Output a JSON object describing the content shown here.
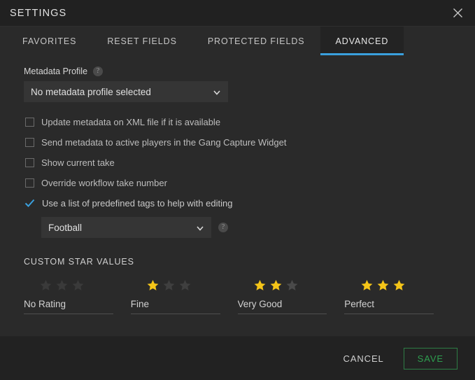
{
  "window": {
    "title": "SETTINGS",
    "close_icon": "close-icon"
  },
  "tabs": [
    {
      "label": "FAVORITES",
      "active": false
    },
    {
      "label": "RESET FIELDS",
      "active": false
    },
    {
      "label": "PROTECTED FIELDS",
      "active": false
    },
    {
      "label": "ADVANCED",
      "active": true
    }
  ],
  "colors": {
    "accent_blue": "#3aa0dd",
    "star_gold": "#f5c518",
    "star_empty": "#3a3a3a",
    "save_green": "#2e9e4f",
    "panel_bg": "#2a2a2a",
    "footer_bg": "#222222"
  },
  "advanced": {
    "metadata_profile": {
      "label": "Metadata Profile",
      "help_icon": "help-icon",
      "selected": "No metadata profile selected"
    },
    "checkboxes": [
      {
        "label": "Update metadata on XML file if it is available",
        "checked": false
      },
      {
        "label": "Send metadata to active players in the Gang Capture Widget",
        "checked": false
      },
      {
        "label": "Show current take",
        "checked": false
      },
      {
        "label": "Override workflow take number",
        "checked": false
      },
      {
        "label": "Use a list of predefined tags to help with editing",
        "checked": true
      }
    ],
    "tag_list": {
      "selected": "Football",
      "help_icon": "help-icon"
    },
    "custom_star_values": {
      "title": "CUSTOM STAR VALUES",
      "columns": [
        {
          "stars": 0,
          "value": "No Rating",
          "placeholder": "No Rating"
        },
        {
          "stars": 1,
          "value": "Fine",
          "placeholder": "Fine"
        },
        {
          "stars": 2,
          "value": "Very Good",
          "placeholder": "Very Good"
        },
        {
          "stars": 3,
          "value": "Perfect",
          "placeholder": "Perfect"
        }
      ],
      "max_stars": 3
    }
  },
  "footer": {
    "cancel_label": "CANCEL",
    "save_label": "SAVE"
  }
}
